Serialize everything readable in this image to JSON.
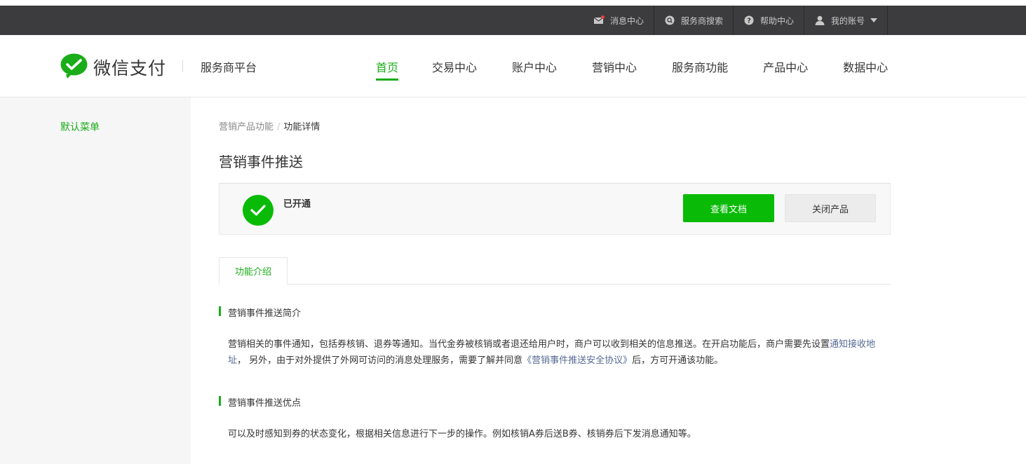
{
  "topbar": {
    "items": [
      {
        "label": "消息中心",
        "icon": "message-icon"
      },
      {
        "label": "服务商搜索",
        "icon": "search-icon"
      },
      {
        "label": "帮助中心",
        "icon": "help-icon"
      },
      {
        "label": "我的账号",
        "icon": "user-icon"
      }
    ]
  },
  "header": {
    "logo_text": "微信支付",
    "platform": "服务商平台",
    "nav": [
      "首页",
      "交易中心",
      "账户中心",
      "营销中心",
      "服务商功能",
      "产品中心",
      "数据中心"
    ],
    "active_nav": "首页"
  },
  "sidebar": {
    "item": "默认菜单"
  },
  "main": {
    "breadcrumb": {
      "parent": "营销产品功能",
      "separator": "/",
      "current": "功能详情"
    },
    "title": "营销事件推送",
    "status": {
      "text": "已开通",
      "icon": "check-circle-icon"
    },
    "buttons": {
      "docs": "查看文档",
      "close": "关闭产品"
    },
    "tab": "功能介绍",
    "section1": {
      "title": "营销事件推送简介",
      "text1": "营销相关的事件通知，包括券核销、退券等通知。当代金券被核销或者退还给用户时，商户可以收到相关的信息推送。在开启功能后，商户需要先设置",
      "link1": "通知接收地址",
      "text2": "，  另外，由于对外提供了外网可访问的消息处理服务，需要了解并同意",
      "link2": "《营销事件推送安全协议》",
      "text3": "后，方可开通该功能。"
    },
    "section2": {
      "title": "营销事件推送优点",
      "text": "可以及时感知到券的状态变化，根据相关信息进行下一步的操作。例如核销A券后送B券、核销券后下发消息通知等。"
    }
  },
  "colors": {
    "accent": "#1aad19",
    "button_green": "#09bb07",
    "topbar": "#3c3c3e",
    "link": "#576b95"
  }
}
